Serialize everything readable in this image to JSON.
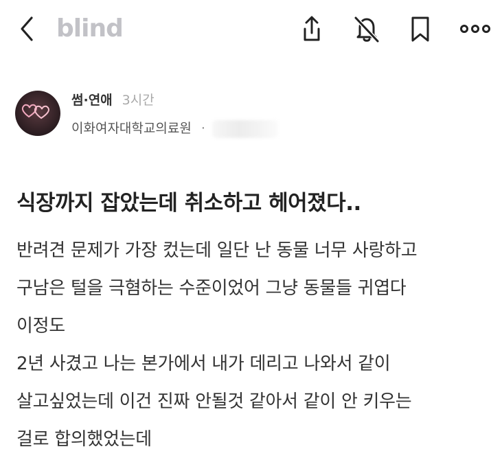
{
  "header": {
    "logo": "blind",
    "icons": [
      "chevron-left-icon",
      "share-icon",
      "bell-off-icon",
      "bookmark-icon",
      "more-icon"
    ]
  },
  "post": {
    "category": "썸·연애",
    "time": "3시간",
    "company": "이화여자대학교의료원",
    "separator": "·",
    "title": "식장까지 잡았는데 취소하고 헤어졌다..",
    "body_lines": [
      "반려견 문제가 가장 컸는데 일단 난 동물 너무 사랑하고",
      "구남은 털을 극혐하는 수준이었어 그냥 동물들 귀엽다",
      "이정도",
      "2년 사겼고 나는 본가에서 내가 데리고 나와서 같이",
      "살고싶었는데 이건 진짜 안될것 같아서 같이 안 키우는",
      "걸로 합의했었는데"
    ]
  },
  "colors": {
    "logo": "#c2c2c7",
    "text": "#222222",
    "muted": "#a9a9a9"
  }
}
